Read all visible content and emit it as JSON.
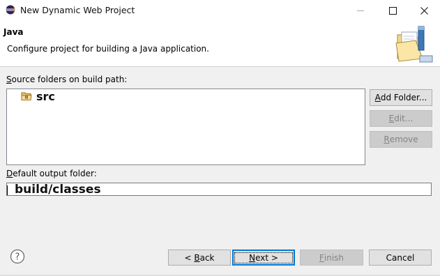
{
  "window": {
    "title": "New Dynamic Web Project",
    "title_icon": "eclipse-icon",
    "controls": [
      "minimize-icon",
      "maximize-icon",
      "close-icon"
    ]
  },
  "header": {
    "title": "Java",
    "description": "Configure project for building a Java application.",
    "image": "folder-wizard-icon"
  },
  "source_folders": {
    "label_mnemonic": "S",
    "label_rest": "ource folders on build path:",
    "items": [
      {
        "label": "src",
        "icon": "package-folder-icon"
      }
    ]
  },
  "side_buttons": {
    "add_folder": {
      "mnemonic": "A",
      "rest": "dd Folder..."
    },
    "edit": {
      "mnemonic": "E",
      "rest": "dit..."
    },
    "remove": {
      "mnemonic": "R",
      "rest": "emove"
    }
  },
  "output": {
    "label_mnemonic": "D",
    "label_rest": "efault output folder:",
    "value": "build/classes"
  },
  "footer": {
    "help_icon": "help-icon",
    "back": {
      "prefix": "< ",
      "mnemonic": "B",
      "rest": "ack"
    },
    "next": {
      "mnemonic": "N",
      "rest": "ext >"
    },
    "finish": {
      "mnemonic": "F",
      "rest": "inish"
    },
    "cancel": {
      "label": "Cancel"
    }
  },
  "colors": {
    "accent": "#0078d7",
    "eclipse_purple": "#2c2255",
    "eclipse_orange": "#f7941e"
  }
}
